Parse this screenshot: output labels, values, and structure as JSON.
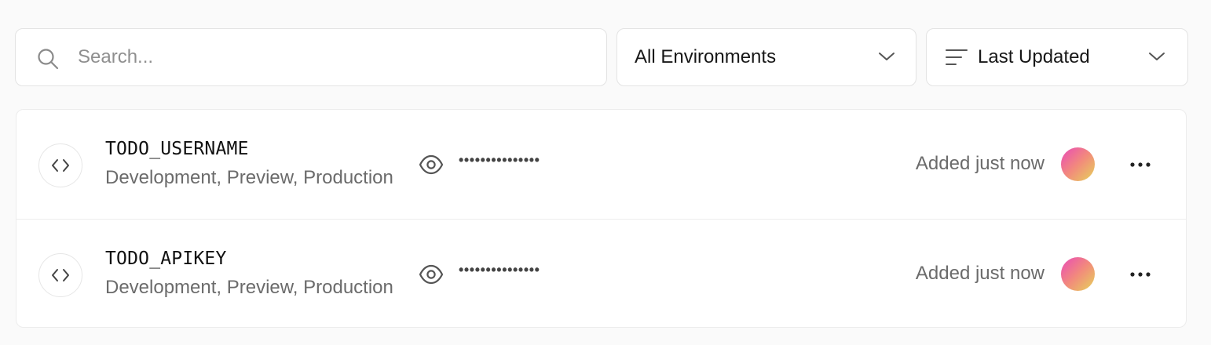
{
  "search": {
    "placeholder": "Search...",
    "value": ""
  },
  "filters": {
    "environment": {
      "selected": "All Environments"
    },
    "sort": {
      "selected": "Last Updated"
    }
  },
  "env_vars": [
    {
      "name": "TODO_USERNAME",
      "environments": "Development, Preview, Production",
      "masked_value": "•••••••••••••••",
      "updated": "Added just now"
    },
    {
      "name": "TODO_APIKEY",
      "environments": "Development, Preview, Production",
      "masked_value": "•••••••••••••••",
      "updated": "Added just now"
    }
  ],
  "icons": {
    "search": "search-icon",
    "chevron": "chevron-down-icon",
    "sort": "sort-lines-icon",
    "code": "code-brackets-icon",
    "eye": "eye-icon",
    "more": "more-horizontal-icon"
  },
  "colors": {
    "background": "#fafafa",
    "border": "#e3e3e3",
    "muted_text": "#6b6b6b",
    "avatar_gradient": [
      "#e94ab8",
      "#f28a7c",
      "#e6d35a"
    ]
  }
}
